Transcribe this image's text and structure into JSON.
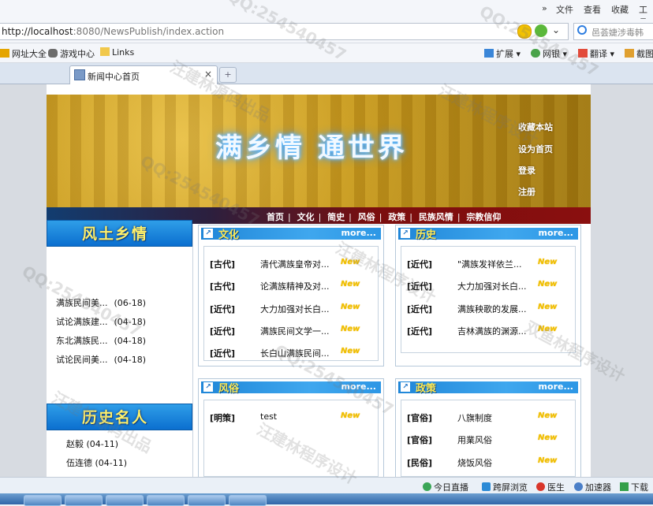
{
  "browser": {
    "menu": [
      "»",
      "文件",
      "查看",
      "收藏",
      "工具"
    ],
    "url_host": "http://localhost",
    "url_rest": ":8080/NewsPublish/index.action",
    "search_placeholder": "邑荟婕涉毒韩",
    "toolbar_right": [
      "扩展",
      "网银",
      "翻译",
      "截图"
    ],
    "favorites": [
      "网址大全",
      "游戏中心",
      "Links"
    ],
    "tab_title": "新闻中心首页",
    "new_tab": "+",
    "status_items": [
      "今日直播",
      "跨屏浏览",
      "医生",
      "加速器",
      "下载"
    ]
  },
  "site": {
    "slogan": "满乡情  通世界",
    "banner_links": [
      "收藏本站",
      "设为首页",
      "登录",
      "注册"
    ],
    "nav": [
      "首页",
      "文化",
      "简史",
      "风俗",
      "政策",
      "民族风情",
      "宗教信仰"
    ],
    "left": {
      "section1_title": "风土乡情",
      "section1_items": [
        {
          "title": "满族民间美...",
          "date": "(06-18)"
        },
        {
          "title": "试论满族建...",
          "date": "(04-18)"
        },
        {
          "title": "东北满族民...",
          "date": "(04-18)"
        },
        {
          "title": "试论民间美...",
          "date": "(04-18)"
        }
      ],
      "section2_title": "历史名人",
      "section2_items": [
        {
          "title": "赵毅",
          "date": "(04-11)"
        },
        {
          "title": "伍连德",
          "date": "(04-11)"
        }
      ]
    },
    "boxes": [
      {
        "title": "文化",
        "more": "more...",
        "new_label": "New",
        "rows": [
          {
            "cat": "[古代]",
            "title": "清代满族皇帝对..."
          },
          {
            "cat": "[古代]",
            "title": "论满族精神及对..."
          },
          {
            "cat": "[近代]",
            "title": "大力加强对长白..."
          },
          {
            "cat": "[近代]",
            "title": "满族民间文学一..."
          },
          {
            "cat": "[近代]",
            "title": "长白山满族民间..."
          }
        ]
      },
      {
        "title": "历史",
        "more": "more...",
        "new_label": "New",
        "rows": [
          {
            "cat": "[近代]",
            "title": "\"满族发祥依兰..."
          },
          {
            "cat": "[近代]",
            "title": "大力加强对长白..."
          },
          {
            "cat": "[近代]",
            "title": "满族秧歌的发展..."
          },
          {
            "cat": "[近代]",
            "title": "吉林满族的渊源..."
          }
        ]
      },
      {
        "title": "风俗",
        "more": "more...",
        "new_label": "New",
        "rows": [
          {
            "cat": "[明策]",
            "title": "test"
          }
        ]
      },
      {
        "title": "政策",
        "more": "more...",
        "new_label": "New",
        "rows": [
          {
            "cat": "[官俗]",
            "title": "八旗制度"
          },
          {
            "cat": "[官俗]",
            "title": "用業风俗"
          },
          {
            "cat": "[民俗]",
            "title": "烧饭风俗"
          }
        ]
      }
    ]
  },
  "watermark": [
    "QQ:254540457",
    "汪建林程序设计",
    "汪建林源码出品",
    "双鱼林程序设计"
  ]
}
